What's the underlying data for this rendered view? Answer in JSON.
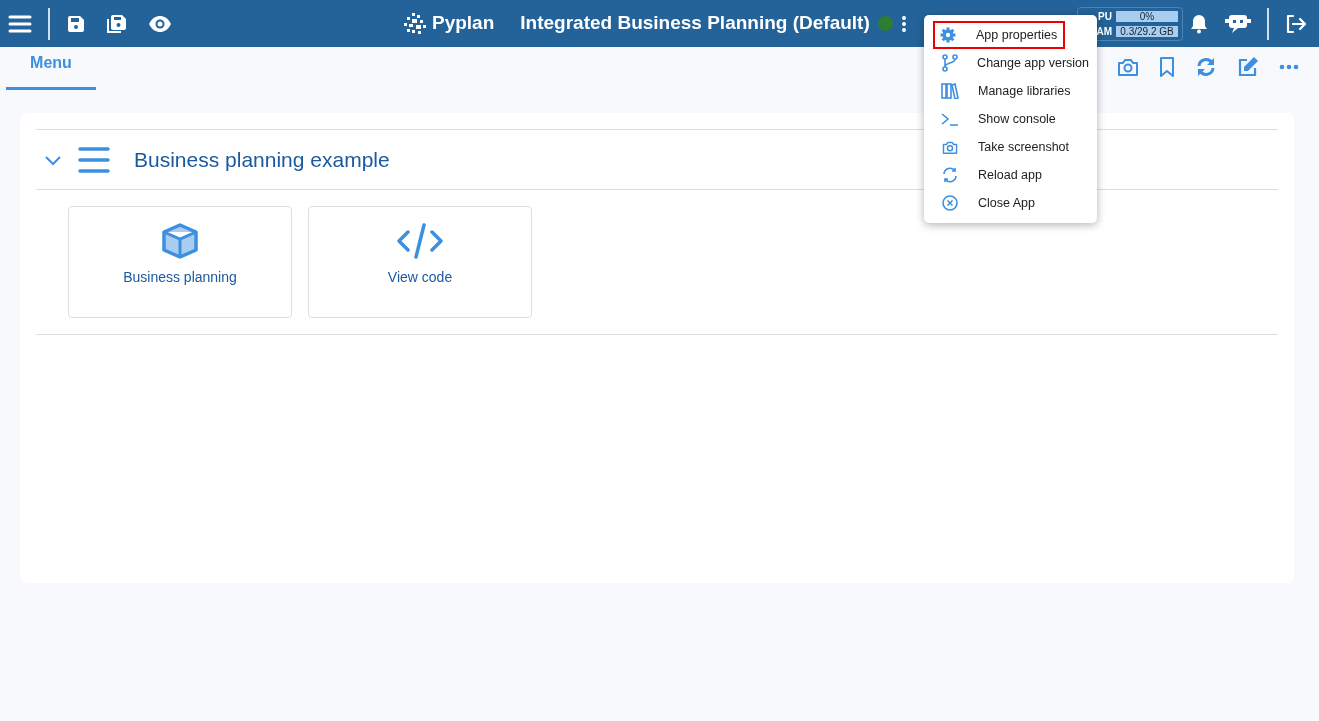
{
  "brand": "Pyplan",
  "app_title": "Integrated Business Planning (Default)",
  "connected": true,
  "resources": [
    {
      "label": "PU",
      "reading": "0%"
    },
    {
      "label": "AM",
      "reading": "0.3/29.2 GB"
    }
  ],
  "tabs": [
    {
      "label": "Menu",
      "selected": true
    }
  ],
  "section": {
    "title": "Business planning example",
    "expanded": true,
    "tiles": [
      {
        "kind": "cube",
        "label": "Business planning"
      },
      {
        "kind": "code",
        "label": "View code"
      }
    ]
  },
  "dropdown_menu": [
    {
      "kind": "gear",
      "label": "App properties",
      "selected": true
    },
    {
      "kind": "branch",
      "label": "Change app version",
      "selected": false
    },
    {
      "kind": "books",
      "label": "Manage libraries",
      "selected": false
    },
    {
      "kind": "console",
      "label": "Show console",
      "selected": false
    },
    {
      "kind": "camera",
      "label": "Take screenshot",
      "selected": false
    },
    {
      "kind": "reload",
      "label": "Reload app",
      "selected": false
    },
    {
      "kind": "close",
      "label": "Close App",
      "selected": false
    }
  ]
}
